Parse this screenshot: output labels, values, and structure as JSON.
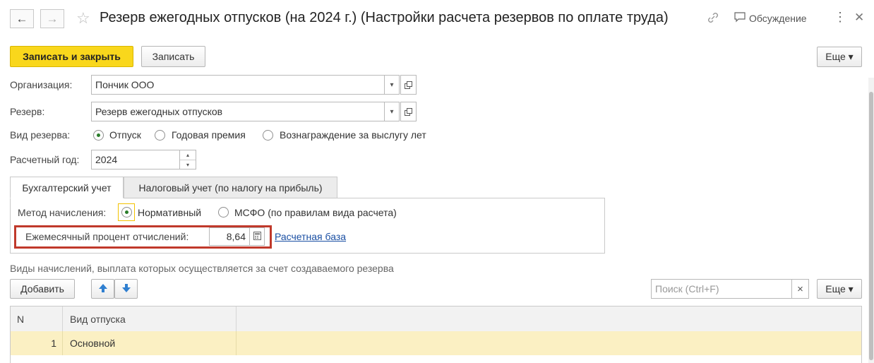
{
  "header": {
    "title": "Резерв ежегодных отпусков (на 2024 г.) (Настройки расчета резервов по оплате труда)",
    "discussion_label": "Обсуждение",
    "back_glyph": "←",
    "forward_glyph": "→",
    "star_glyph": "☆",
    "more_glyph": "⋮",
    "close_glyph": "✕",
    "link_icon": "link-icon",
    "discussion_icon": "chat-icon"
  },
  "toolbar": {
    "save_close_label": "Записать и закрыть",
    "save_label": "Записать",
    "more_label": "Еще ▾"
  },
  "form": {
    "organization_label": "Организация:",
    "organization_value": "Пончик ООО",
    "reserve_label": "Резерв:",
    "reserve_value": "Резерв ежегодных отпусков",
    "reserve_type_label": "Вид резерва:",
    "reserve_type_options": [
      "Отпуск",
      "Годовая премия",
      "Вознаграждение за выслугу лет"
    ],
    "reserve_type_selected": "Отпуск",
    "year_label": "Расчетный год:",
    "year_value": "2024"
  },
  "tabs": [
    {
      "label": "Бухгалтерский учет",
      "active": true
    },
    {
      "label": "Налоговый учет (по налогу на прибыль)",
      "active": false
    }
  ],
  "accounting": {
    "method_label": "Метод начисления:",
    "method_options": [
      "Нормативный",
      "МСФО (по правилам вида расчета)"
    ],
    "method_selected": "Нормативный",
    "percent_label": "Ежемесячный процент отчислений:",
    "percent_value": "8,64",
    "base_link": "Расчетная база"
  },
  "accruals": {
    "section_label": "Виды начислений, выплата которых осуществляется за счет создаваемого резерва",
    "add_label": "Добавить",
    "search_placeholder": "Поиск (Ctrl+F)",
    "clear_glyph": "×",
    "more_label": "Еще ▾",
    "columns": [
      "N",
      "Вид отпуска"
    ],
    "rows": [
      {
        "n": "1",
        "type": "Основной"
      }
    ]
  },
  "colors": {
    "primary_button": "#f9d71c",
    "highlight_box": "#c0392b",
    "selected_row": "#fbf0c3",
    "link": "#1a4fa3"
  }
}
